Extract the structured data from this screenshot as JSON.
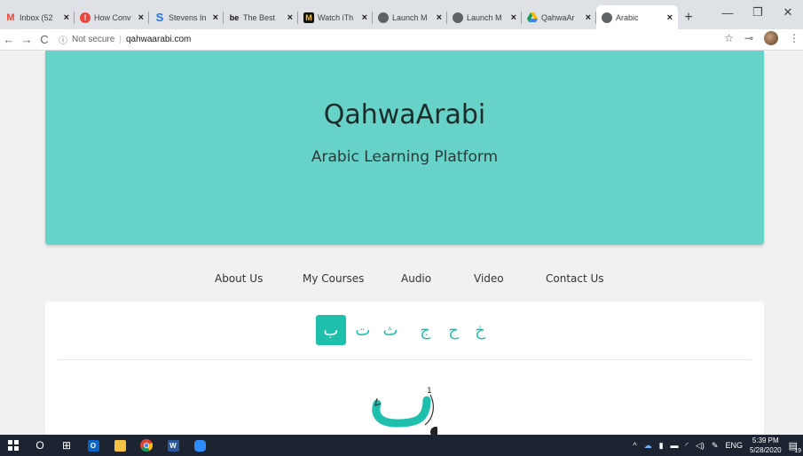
{
  "browser": {
    "tabs": [
      {
        "title": "Inbox (52",
        "favicon": "gmail-icon",
        "color": "#ea4335",
        "glyph": "M"
      },
      {
        "title": "How Conv",
        "favicon": "alert-icon",
        "color": "#e8453c",
        "glyph": "!"
      },
      {
        "title": "Stevens In",
        "favicon": "stevens-icon",
        "color": "#1a73e8",
        "glyph": "S"
      },
      {
        "title": "The Best",
        "favicon": "behance-icon",
        "color": "#111111",
        "glyph": "be"
      },
      {
        "title": "Watch iTh",
        "favicon": "tv-icon",
        "color": "#111111",
        "glyph": "M"
      },
      {
        "title": "Launch M",
        "favicon": "globe-icon",
        "color": "#5f6368",
        "glyph": "◍"
      },
      {
        "title": "Launch M",
        "favicon": "globe-icon",
        "color": "#5f6368",
        "glyph": "◍"
      },
      {
        "title": "QahwaAr",
        "favicon": "drive-icon",
        "color": "#fbbc04",
        "glyph": "▲"
      },
      {
        "title": "Arabic",
        "favicon": "globe-icon",
        "color": "#5f6368",
        "glyph": "◍",
        "active": true
      }
    ],
    "new_tab": "+",
    "window": {
      "minimize": "—",
      "restore": "❐",
      "close": "✕"
    },
    "nav": {
      "back": "←",
      "forward": "→",
      "reload": "C"
    },
    "address": {
      "security": "Not secure",
      "url": "qahwaarabi.com"
    },
    "toolbar_icons": {
      "star": "☆",
      "key": "⊸"
    }
  },
  "site": {
    "title": "QahwaArabi",
    "subtitle": "Arabic Learning Platform",
    "nav": [
      "About Us",
      "My Courses",
      "Audio",
      "Video",
      "Contact Us"
    ],
    "letters": [
      "ب",
      "ت",
      "ث",
      "ج",
      "ح",
      "خ"
    ],
    "active_letter": 0,
    "stroke_number": "1",
    "accent": "#1fbfae",
    "hero_bg": "#67d2c7"
  },
  "taskbar": {
    "search": "O",
    "tray": {
      "lang": "ENG",
      "time": "5:39 PM",
      "date": "5/28/2020",
      "notifications": "19"
    }
  }
}
